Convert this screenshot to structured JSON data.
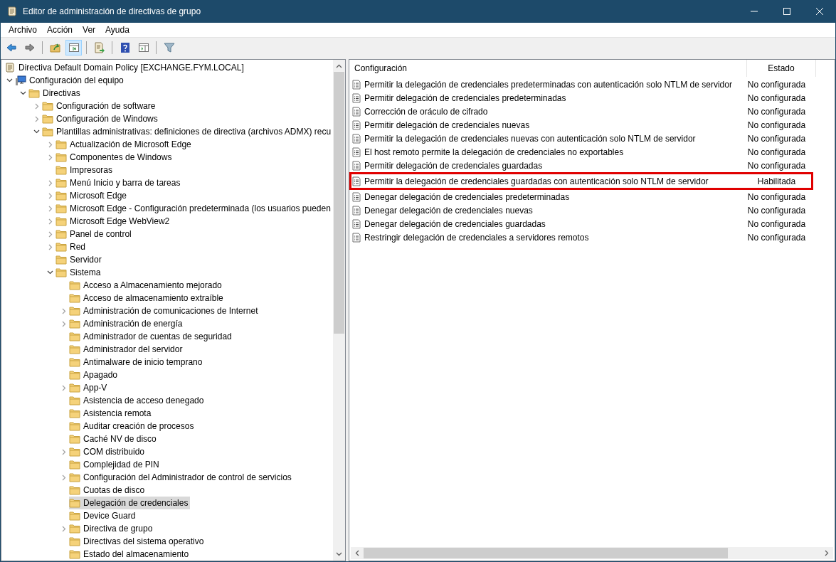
{
  "window": {
    "title": "Editor de administración de directivas de grupo"
  },
  "menu": [
    "Archivo",
    "Acción",
    "Ver",
    "Ayuda"
  ],
  "toolbar": [
    {
      "kind": "back",
      "pressed": false
    },
    {
      "kind": "forward",
      "pressed": false
    },
    {
      "kind": "separator"
    },
    {
      "kind": "up",
      "pressed": false
    },
    {
      "kind": "tree",
      "pressed": true
    },
    {
      "kind": "separator"
    },
    {
      "kind": "export",
      "pressed": false
    },
    {
      "kind": "separator"
    },
    {
      "kind": "help",
      "pressed": false
    },
    {
      "kind": "properties",
      "pressed": false
    },
    {
      "kind": "separator"
    },
    {
      "kind": "filter",
      "pressed": false
    }
  ],
  "tree": [
    {
      "label": "Directiva Default Domain Policy [EXCHANGE.FYM.LOCAL]",
      "kind": "policy",
      "selected": false,
      "children": [
        {
          "label": "Configuración del equipo",
          "kind": "computer",
          "expanded": true,
          "selected": false,
          "children": [
            {
              "label": "Directivas",
              "kind": "folder",
              "expanded": true,
              "selected": false,
              "children": [
                {
                  "label": "Configuración de software",
                  "kind": "folder",
                  "expanded": false,
                  "selected": false
                },
                {
                  "label": "Configuración de Windows",
                  "kind": "folder",
                  "expanded": false,
                  "selected": false
                },
                {
                  "label": "Plantillas administrativas: definiciones de directiva (archivos ADMX) recu",
                  "kind": "folder",
                  "expanded": true,
                  "selected": false,
                  "children": [
                    {
                      "label": "Actualización de Microsoft Edge",
                      "kind": "folder",
                      "expanded": false,
                      "selected": false
                    },
                    {
                      "label": "Componentes de Windows",
                      "kind": "folder",
                      "expanded": false,
                      "selected": false
                    },
                    {
                      "label": "Impresoras",
                      "kind": "folder",
                      "selected": false
                    },
                    {
                      "label": "Menú Inicio y barra de tareas",
                      "kind": "folder",
                      "expanded": false,
                      "selected": false
                    },
                    {
                      "label": "Microsoft Edge",
                      "kind": "folder",
                      "expanded": false,
                      "selected": false
                    },
                    {
                      "label": "Microsoft Edge - Configuración predeterminada (los usuarios pueden",
                      "kind": "folder",
                      "expanded": false,
                      "selected": false
                    },
                    {
                      "label": "Microsoft Edge WebView2",
                      "kind": "folder",
                      "expanded": false,
                      "selected": false
                    },
                    {
                      "label": "Panel de control",
                      "kind": "folder",
                      "expanded": false,
                      "selected": false
                    },
                    {
                      "label": "Red",
                      "kind": "folder",
                      "expanded": false,
                      "selected": false
                    },
                    {
                      "label": "Servidor",
                      "kind": "folder",
                      "selected": false
                    },
                    {
                      "label": "Sistema",
                      "kind": "folder",
                      "expanded": true,
                      "selected": false,
                      "children": [
                        {
                          "label": "Acceso a Almacenamiento mejorado",
                          "kind": "folder",
                          "selected": false
                        },
                        {
                          "label": "Acceso de almacenamiento extraíble",
                          "kind": "folder",
                          "selected": false
                        },
                        {
                          "label": "Administración de comunicaciones de Internet",
                          "kind": "folder",
                          "expanded": false,
                          "selected": false
                        },
                        {
                          "label": "Administración de energía",
                          "kind": "folder",
                          "expanded": false,
                          "selected": false
                        },
                        {
                          "label": "Administrador de cuentas de seguridad",
                          "kind": "folder",
                          "selected": false
                        },
                        {
                          "label": "Administrador del servidor",
                          "kind": "folder",
                          "selected": false
                        },
                        {
                          "label": "Antimalware de inicio temprano",
                          "kind": "folder",
                          "selected": false
                        },
                        {
                          "label": "Apagado",
                          "kind": "folder",
                          "selected": false
                        },
                        {
                          "label": "App-V",
                          "kind": "folder",
                          "expanded": false,
                          "selected": false
                        },
                        {
                          "label": "Asistencia de acceso denegado",
                          "kind": "folder",
                          "selected": false
                        },
                        {
                          "label": "Asistencia remota",
                          "kind": "folder",
                          "selected": false
                        },
                        {
                          "label": "Auditar creación de procesos",
                          "kind": "folder",
                          "selected": false
                        },
                        {
                          "label": "Caché NV de disco",
                          "kind": "folder",
                          "selected": false
                        },
                        {
                          "label": "COM distribuido",
                          "kind": "folder",
                          "expanded": false,
                          "selected": false
                        },
                        {
                          "label": "Complejidad de PIN",
                          "kind": "folder",
                          "selected": false
                        },
                        {
                          "label": "Configuración del Administrador de control de servicios",
                          "kind": "folder",
                          "expanded": false,
                          "selected": false
                        },
                        {
                          "label": "Cuotas de disco",
                          "kind": "folder",
                          "selected": false
                        },
                        {
                          "label": "Delegación de credenciales",
                          "kind": "folder",
                          "selected": true
                        },
                        {
                          "label": "Device Guard",
                          "kind": "folder",
                          "selected": false
                        },
                        {
                          "label": "Directiva de grupo",
                          "kind": "folder",
                          "expanded": false,
                          "selected": false
                        },
                        {
                          "label": "Directivas del sistema operativo",
                          "kind": "folder",
                          "selected": false
                        },
                        {
                          "label": "Estado del almacenamiento",
                          "kind": "folder",
                          "selected": false
                        }
                      ]
                    }
                  ]
                }
              ]
            }
          ]
        }
      ]
    }
  ],
  "table": {
    "columns": [
      "Configuración",
      "Estado"
    ],
    "rows": [
      {
        "setting": "Permitir la delegación de credenciales predeterminadas con autenticación solo NTLM de servidor",
        "state": "No configurada",
        "highlighted": false
      },
      {
        "setting": "Permitir delegación de credenciales predeterminadas",
        "state": "No configurada",
        "highlighted": false
      },
      {
        "setting": "Corrección de oráculo de cifrado",
        "state": "No configurada",
        "highlighted": false
      },
      {
        "setting": "Permitir delegación de credenciales nuevas",
        "state": "No configurada",
        "highlighted": false
      },
      {
        "setting": "Permitir la delegación de credenciales nuevas con autenticación solo NTLM de servidor",
        "state": "No configurada",
        "highlighted": false
      },
      {
        "setting": "El host remoto permite la delegación de credenciales no exportables",
        "state": "No configurada",
        "highlighted": false
      },
      {
        "setting": "Permitir delegación de credenciales guardadas",
        "state": "No configurada",
        "highlighted": false
      },
      {
        "setting": "Permitir la delegación de credenciales guardadas con autenticación solo NTLM de servidor",
        "state": "Habilitada",
        "highlighted": true
      },
      {
        "setting": "Denegar delegación de credenciales predeterminadas",
        "state": "No configurada",
        "highlighted": false
      },
      {
        "setting": "Denegar delegación de credenciales nuevas",
        "state": "No configurada",
        "highlighted": false
      },
      {
        "setting": "Denegar delegación de credenciales guardadas",
        "state": "No configurada",
        "highlighted": false
      },
      {
        "setting": "Restringir delegación de credenciales a servidores remotos",
        "state": "No configurada",
        "highlighted": false
      }
    ]
  }
}
